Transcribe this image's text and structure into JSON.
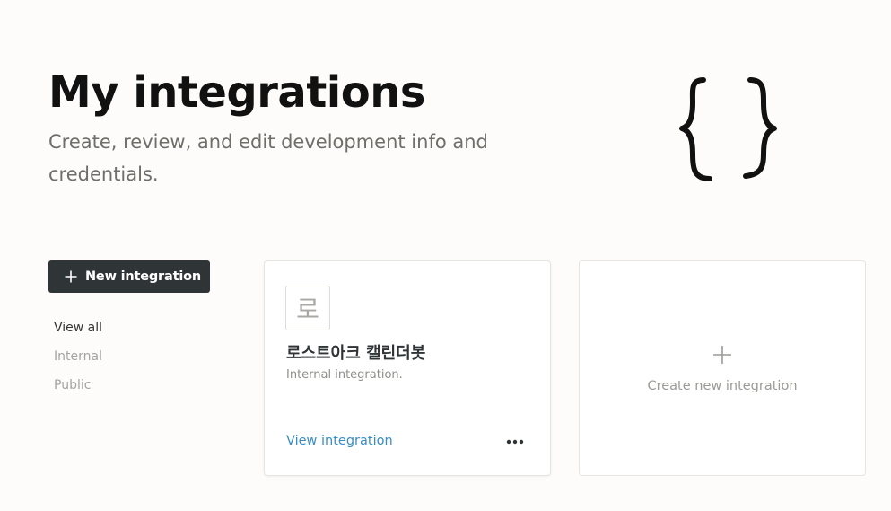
{
  "header": {
    "title": "My integrations",
    "subtitle": "Create, review, and edit development info and credentials.",
    "illustration_icon": "curly-braces"
  },
  "toolbar": {
    "new_integration_label": "New integration",
    "new_integration_icon": "plus"
  },
  "filters": [
    {
      "label": "View all",
      "active": true
    },
    {
      "label": "Internal",
      "active": false
    },
    {
      "label": "Public",
      "active": false
    }
  ],
  "integrations": [
    {
      "avatar_letter": "로",
      "name": "로스트아크 캘린더봇",
      "description": "Internal integration.",
      "view_label": "View integration",
      "more_icon": "ellipsis-horizontal"
    }
  ],
  "create_card": {
    "label": "Create new integration",
    "icon": "plus"
  },
  "colors": {
    "background": "#fdfcfb",
    "button_bg": "#2f3437",
    "link": "#3a8dc4",
    "muted_text": "#a5a4a0"
  }
}
